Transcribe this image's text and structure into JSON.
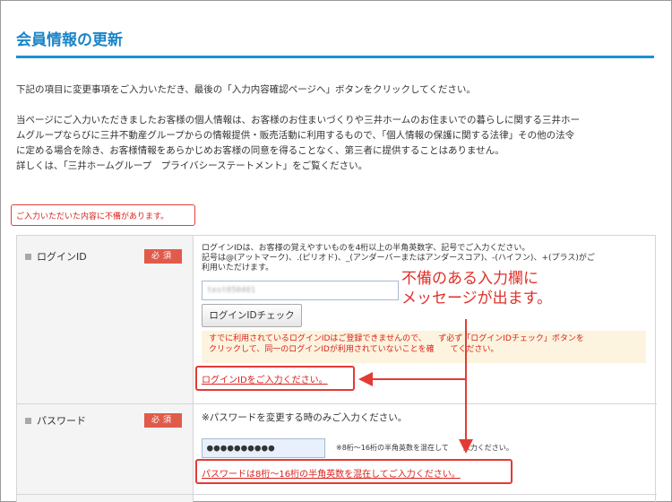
{
  "page": {
    "title": "会員情報の更新",
    "intro": "下記の項目に変更事項をご入力いただき、最後の「入力内容確認ページへ」ボタンをクリックしてください。",
    "privacy_lines": [
      "当ページにご入力いただきましたお客様の個人情報は、お客様のお住まいづくりや三井ホームのお住まいでの暮らしに関する三井ホー",
      "ムグループならびに三井不動産グループからの情報提供・販売活動に利用するもので、「個人情報の保護に関する法律」その他の法令",
      "に定める場合を除き、お客様情報をあらかじめお客様の同意を得ることなく、第三者に提供することはありません。",
      "詳しくは、「三井ホームグループ　プライバシーステートメント」をご覧ください。"
    ],
    "form_error": "ご入力いただいた内容に不備があります。"
  },
  "login": {
    "label": "ログインID",
    "required": "必須",
    "help_lines": [
      "ログインIDは、お客様の覚えやすいものを4桁以上の半角英数字、記号でご入力ください。",
      "記号は@(アットマーク)、.(ピリオド)、_(アンダーバーまたはアンダースコア)、-(ハイフン)、+(プラス)がご",
      "利用いただけます。"
    ],
    "value": "test050401",
    "check_button": "ログインIDチェック",
    "warning_lines": [
      "すでに利用されているログインIDはご登録できませんので、　　ず必ず「ログインIDチェック」ボタンを",
      "クリックして、同一のログインIDが利用されていないことを確　　てください。"
    ],
    "error": "ログインIDをご入力ください。"
  },
  "password": {
    "label": "パスワード",
    "required": "必須",
    "help": "※パスワードを変更する時のみご入力ください。",
    "value": "●●●●●●●●●●",
    "note": "※8桁～16桁の半角英数を混在して　　入力ください。",
    "error": "パスワードは8桁～16桁の半角英数を混在してご入力ください。"
  },
  "annotation": {
    "line1": "不備のある入力欄に",
    "line2": "メッセージが出ます。"
  }
}
